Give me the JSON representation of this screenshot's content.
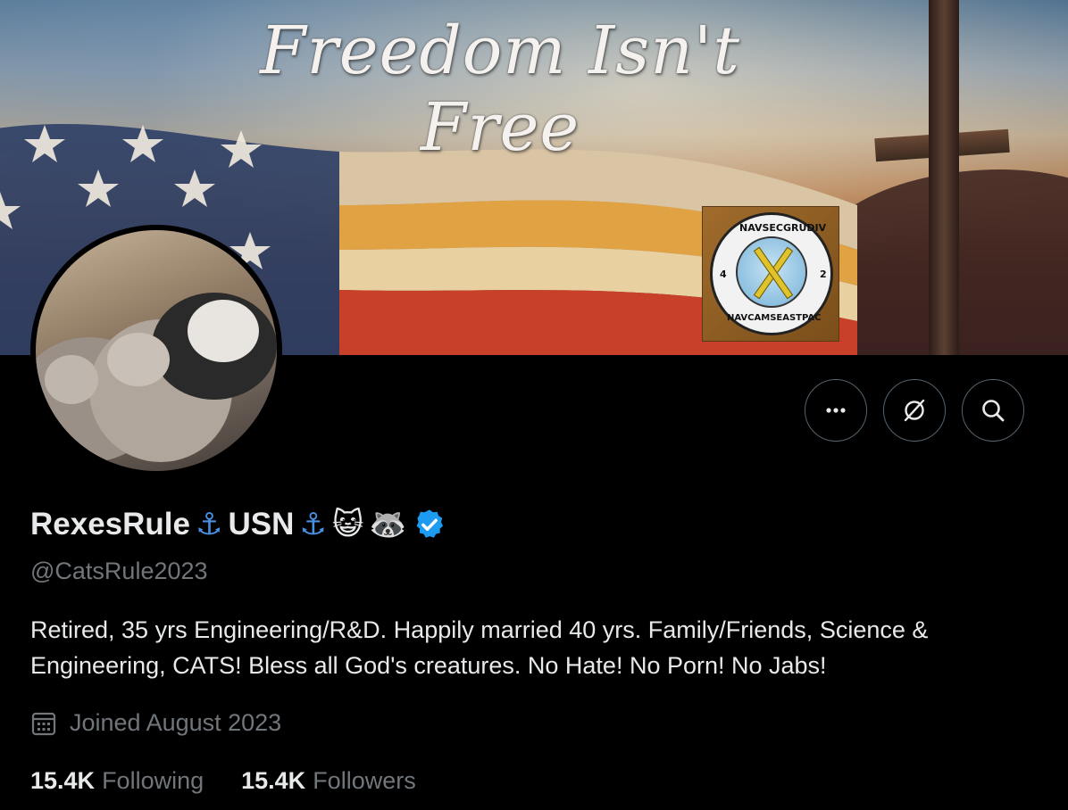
{
  "banner": {
    "title": "Freedom Isn't Free",
    "patch": {
      "top_text": "NAVSECGRUDIV",
      "bottom_text": "NAVCAMSEASTPAC",
      "left_num": "4",
      "right_num": "2"
    }
  },
  "profile": {
    "display_name": "RexesRule",
    "name_part2": "USN",
    "emoji": {
      "anchor": "⚓",
      "cat": "😺",
      "raccoon": "🦝"
    },
    "verified": true,
    "handle": "@CatsRule2023",
    "bio": "Retired, 35 yrs Engineering/R&D.  Happily married 40 yrs. Family/Friends, Science & Engineering, CATS!  Bless all God's creatures. No Hate! No Porn! No Jabs!",
    "joined": "Joined August 2023",
    "following_count": "15.4K",
    "following_label": "Following",
    "followers_count": "15.4K",
    "followers_label": "Followers"
  },
  "actions": {
    "more_icon": "more-horizontal-icon",
    "grok_icon": "grok-icon",
    "search_icon": "search-icon"
  },
  "colors": {
    "background": "#000000",
    "text_primary": "#e7e9ea",
    "text_secondary": "#71767b",
    "verified": "#1d9bf0",
    "button_border": "#536471"
  }
}
